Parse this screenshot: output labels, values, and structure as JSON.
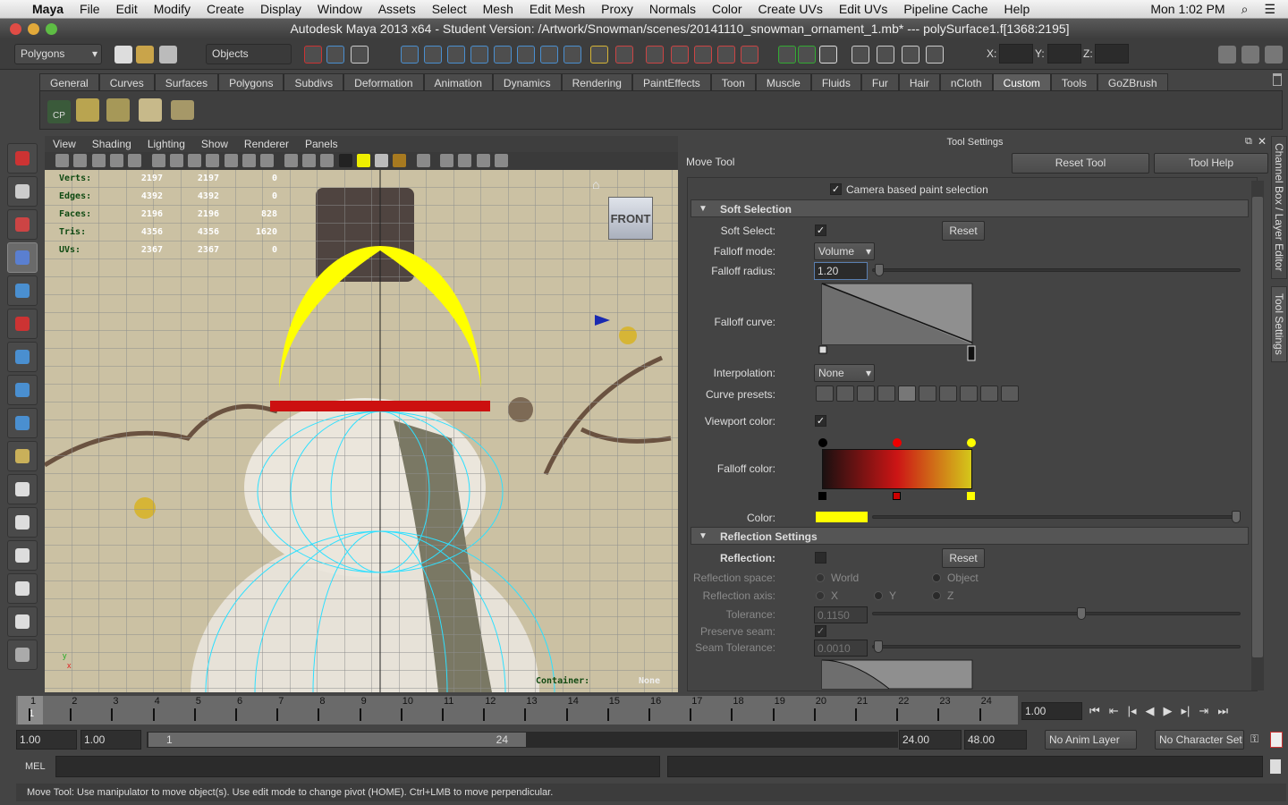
{
  "mac_menubar": {
    "app": "Maya",
    "items": [
      "File",
      "Edit",
      "Modify",
      "Create",
      "Display",
      "Window",
      "Assets",
      "Select",
      "Mesh",
      "Edit Mesh",
      "Proxy",
      "Normals",
      "Color",
      "Create UVs",
      "Edit UVs",
      "Pipeline Cache",
      "Help"
    ],
    "clock": "Mon 1:02 PM"
  },
  "window": {
    "title": "Autodesk Maya 2013 x64 - Student Version: /Artwork/Snowman/scenes/20141110_snowman_ornament_1.mb*   ---   polySurface1.f[1368:2195]"
  },
  "status_line": {
    "menu_set": "Polygons",
    "selection_mask": "Objects",
    "x_label": "X:",
    "y_label": "Y:",
    "z_label": "Z:",
    "x": "",
    "y": "",
    "z": ""
  },
  "shelf": {
    "tabs": [
      "General",
      "Curves",
      "Surfaces",
      "Polygons",
      "Subdivs",
      "Deformation",
      "Animation",
      "Dynamics",
      "Rendering",
      "PaintEffects",
      "Toon",
      "Muscle",
      "Fluids",
      "Fur",
      "Hair",
      "nCloth",
      "Custom",
      "Tools",
      "GoZBrush"
    ],
    "active_tab": "Custom",
    "first_icon_label": "CP"
  },
  "viewport": {
    "menu": [
      "View",
      "Shading",
      "Lighting",
      "Show",
      "Renderer",
      "Panels"
    ],
    "hud": [
      {
        "label": "Verts:",
        "a": "2197",
        "b": "2197",
        "c": "0"
      },
      {
        "label": "Edges:",
        "a": "4392",
        "b": "4392",
        "c": "0"
      },
      {
        "label": "Faces:",
        "a": "2196",
        "b": "2196",
        "c": "828"
      },
      {
        "label": "Tris:",
        "a": "4356",
        "b": "4356",
        "c": "1620"
      },
      {
        "label": "UVs:",
        "a": "2367",
        "b": "2367",
        "c": "0"
      }
    ],
    "view_cube": "FRONT",
    "container_label": "Container:",
    "container_value": "None"
  },
  "tool_settings": {
    "header": "Tool Settings",
    "tool_name": "Move Tool",
    "reset_tool": "Reset Tool",
    "tool_help": "Tool Help",
    "camera_paint": {
      "label": "Camera based paint selection",
      "checked": true
    },
    "soft_selection": {
      "title": "Soft Selection",
      "soft_select_label": "Soft Select:",
      "soft_select": true,
      "reset": "Reset",
      "falloff_mode_label": "Falloff mode:",
      "falloff_mode": "Volume",
      "falloff_radius_label": "Falloff radius:",
      "falloff_radius": "1.20",
      "falloff_curve_label": "Falloff curve:",
      "interpolation_label": "Interpolation:",
      "interpolation": "None",
      "curve_presets_label": "Curve presets:",
      "viewport_color_label": "Viewport color:",
      "viewport_color": true,
      "falloff_color_label": "Falloff color:",
      "gradient_colors": [
        "#1a1010",
        "#cc1515",
        "#d4c81a"
      ],
      "color_label": "Color:",
      "color": "#ffff00"
    },
    "reflection": {
      "title": "Reflection Settings",
      "reflection_label": "Reflection:",
      "reflection": false,
      "reset": "Reset",
      "space_label": "Reflection space:",
      "space_options": [
        "World",
        "Object"
      ],
      "axis_label": "Reflection axis:",
      "axis_options": [
        "X",
        "Y",
        "Z"
      ],
      "tolerance_label": "Tolerance:",
      "tolerance": "0.1150",
      "preserve_seam_label": "Preserve seam:",
      "preserve_seam": true,
      "seam_tolerance_label": "Seam Tolerance:",
      "seam_tolerance": "0.0010"
    }
  },
  "side_tabs": [
    "Channel Box / Layer Editor",
    "Tool Settings"
  ],
  "timeline": {
    "ticks": [
      "1",
      "2",
      "3",
      "4",
      "5",
      "6",
      "7",
      "8",
      "9",
      "10",
      "11",
      "12",
      "13",
      "14",
      "15",
      "16",
      "17",
      "18",
      "19",
      "20",
      "21",
      "22",
      "23",
      "24"
    ],
    "current_frame": "1",
    "current_time": "1.00"
  },
  "range": {
    "start": "1.00",
    "anim_start": "1.00",
    "slider_start": "1",
    "slider_end": "24",
    "anim_end": "24.00",
    "end": "48.00",
    "anim_layer": "No Anim Layer",
    "character_set": "No Character Set"
  },
  "command_line": {
    "label": "MEL",
    "input": "",
    "output": ""
  },
  "help_line": "Move Tool: Use manipulator to move object(s). Use edit mode to change pivot (HOME).  Ctrl+LMB to move perpendicular."
}
